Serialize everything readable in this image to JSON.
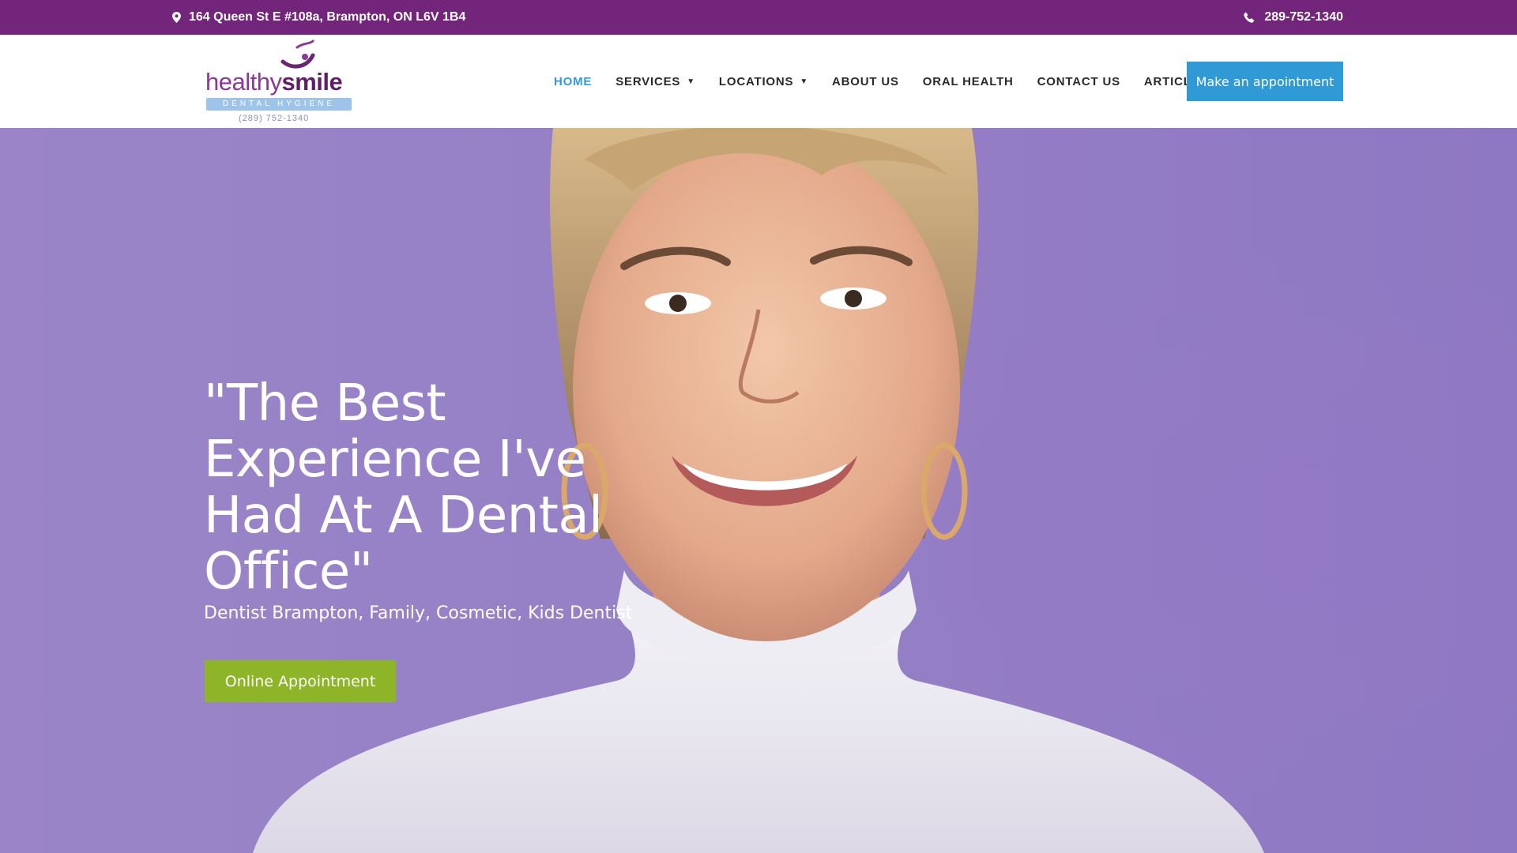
{
  "topbar": {
    "address": "164 Queen St E #108a, Brampton, ON L6V 1B4",
    "address_icon": "map-pin-icon",
    "phone": "289-752-1340",
    "phone_icon": "phone-icon",
    "background": "#72257a"
  },
  "logo": {
    "word_light": "healthy",
    "word_bold": "smile",
    "tagline": "DENTAL HYGIENE",
    "phone": "(289) 752-1340"
  },
  "nav": {
    "items": [
      {
        "label": "HOME",
        "active": true
      },
      {
        "label": "SERVICES",
        "dropdown": true
      },
      {
        "label": "LOCATIONS",
        "dropdown": true
      },
      {
        "label": "ABOUT US"
      },
      {
        "label": "ORAL HEALTH"
      },
      {
        "label": "CONTACT US"
      },
      {
        "label": "ARTICLES"
      }
    ],
    "cta_label": "Make an appointment",
    "active_color": "#2f9ad6"
  },
  "hero": {
    "headline": "\"The Best Experience I've Had At A Dental Office\"",
    "subheadline": "Dentist Brampton, Family, Cosmetic, Kids Dentist",
    "cta_label": "Online Appointment",
    "cta_color": "#8db527",
    "background_color": "#9680c6"
  }
}
